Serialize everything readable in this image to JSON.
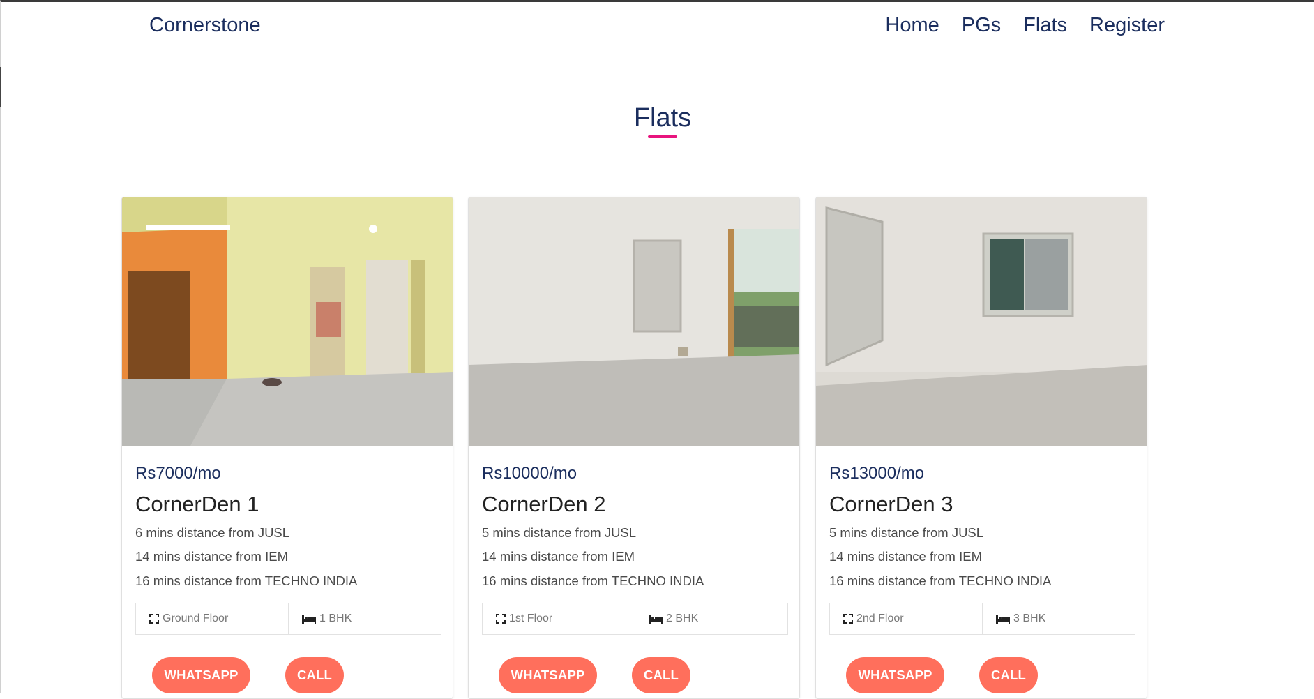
{
  "navbar": {
    "brand": "Cornerstone",
    "links": [
      "Home",
      "PGs",
      "Flats",
      "Register"
    ]
  },
  "section": {
    "title": "Flats"
  },
  "accent_colors": {
    "title_underline": "#e8147e",
    "button": "#ff6f5c",
    "navy": "#1b2e5e"
  },
  "cards": [
    {
      "price": "Rs7000/mo",
      "name": "CornerDen 1",
      "distances": [
        "6 mins distance from JUSL",
        "14 mins distance from IEM",
        "16 mins distance from TECHNO INDIA"
      ],
      "floor": "Ground Floor",
      "bhk": "1 BHK",
      "whatsapp_label": "WHATSAPP",
      "call_label": "CALL"
    },
    {
      "price": "Rs10000/mo",
      "name": "CornerDen 2",
      "distances": [
        "5 mins distance from JUSL",
        "14 mins distance from IEM",
        "16 mins distance from TECHNO INDIA"
      ],
      "floor": "1st Floor",
      "bhk": "2 BHK",
      "whatsapp_label": "WHATSAPP",
      "call_label": "CALL"
    },
    {
      "price": "Rs13000/mo",
      "name": "CornerDen 3",
      "distances": [
        "5 mins distance from JUSL",
        "14 mins distance from IEM",
        "16 mins distance from TECHNO INDIA"
      ],
      "floor": "2nd Floor",
      "bhk": "3 BHK",
      "whatsapp_label": "WHATSAPP",
      "call_label": "CALL"
    }
  ],
  "icons": {
    "floor": "expand-icon",
    "bhk": "bed-icon"
  }
}
